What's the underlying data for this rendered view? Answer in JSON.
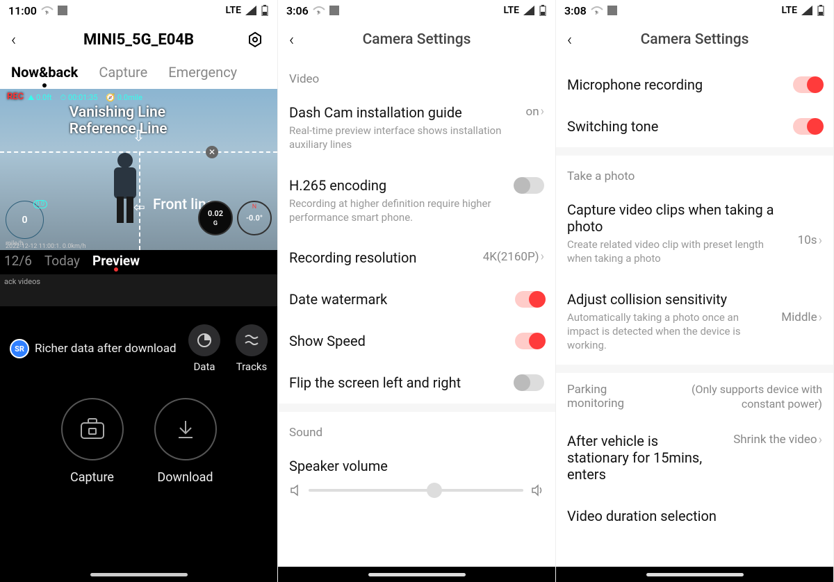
{
  "phone1": {
    "status": {
      "time": "11:00",
      "net": "LTE"
    },
    "title": "MINI5_5G_E04B",
    "tabs": [
      "Now&back",
      "Capture",
      "Emergency"
    ],
    "activeTab": 0,
    "preview": {
      "vanishing_label": "Vanishing Line Reference Line",
      "front_label": "Front line",
      "info": {
        "alt": "0.0ft",
        "time": "00:01:35",
        "dist": "0.0mile"
      },
      "speed": {
        "value": "0",
        "unit": "mile/h",
        "alt_label": "0.0"
      },
      "g": {
        "value": "0.02",
        "unit": "G"
      },
      "compass": {
        "value": "-0.0°",
        "dir": "N"
      },
      "readout": "2022-12-12  11:00:1.  0.0km/h"
    },
    "dateTabs": [
      "12/6",
      "Today",
      "Preview"
    ],
    "activeDateTab": 2,
    "timeline_left_label": "ack videos",
    "richer_label": "Richer data after download",
    "sr": "SR",
    "iconButtons": {
      "data": "Data",
      "tracks": "Tracks"
    },
    "bigButtons": {
      "capture": "Capture",
      "download": "Download"
    }
  },
  "phone2": {
    "status": {
      "time": "3:06",
      "net": "LTE"
    },
    "title": "Camera Settings",
    "section_video": "Video",
    "rows": {
      "install_guide": {
        "label": "Dash Cam installation guide",
        "desc": "Real-time preview interface shows installation auxiliary lines",
        "value": "on"
      },
      "h265": {
        "label": "H.265 encoding",
        "desc": "Recording at higher definition require higher performance smart phone."
      },
      "resolution": {
        "label": "Recording resolution",
        "value": "4K(2160P)"
      },
      "date_watermark": {
        "label": "Date watermark"
      },
      "show_speed": {
        "label": "Show Speed"
      },
      "flip": {
        "label": "Flip the screen left and right"
      }
    },
    "section_sound": "Sound",
    "speaker": {
      "label": "Speaker volume"
    }
  },
  "phone3": {
    "status": {
      "time": "3:08",
      "net": "LTE"
    },
    "title": "Camera Settings",
    "rows": {
      "mic": {
        "label": "Microphone recording"
      },
      "switching": {
        "label": "Switching tone"
      }
    },
    "section_photo": "Take a photo",
    "photo_rows": {
      "capture_clip": {
        "label": "Capture video clips when taking a photo",
        "value": "10s",
        "desc": "Create related video clip with preset length when taking a photo"
      },
      "collision": {
        "label": "Adjust collision sensitivity",
        "value": "Middle",
        "desc": "Automatically taking a photo once an impact is detected when the device is working."
      }
    },
    "parking": {
      "header": "Parking monitoring",
      "note": "(Only supports device with constant power)"
    },
    "after_stationary": {
      "label": "After vehicle is stationary for 15mins, enters",
      "value": "Shrink the video"
    },
    "video_duration": {
      "label": "Video duration selection"
    }
  }
}
